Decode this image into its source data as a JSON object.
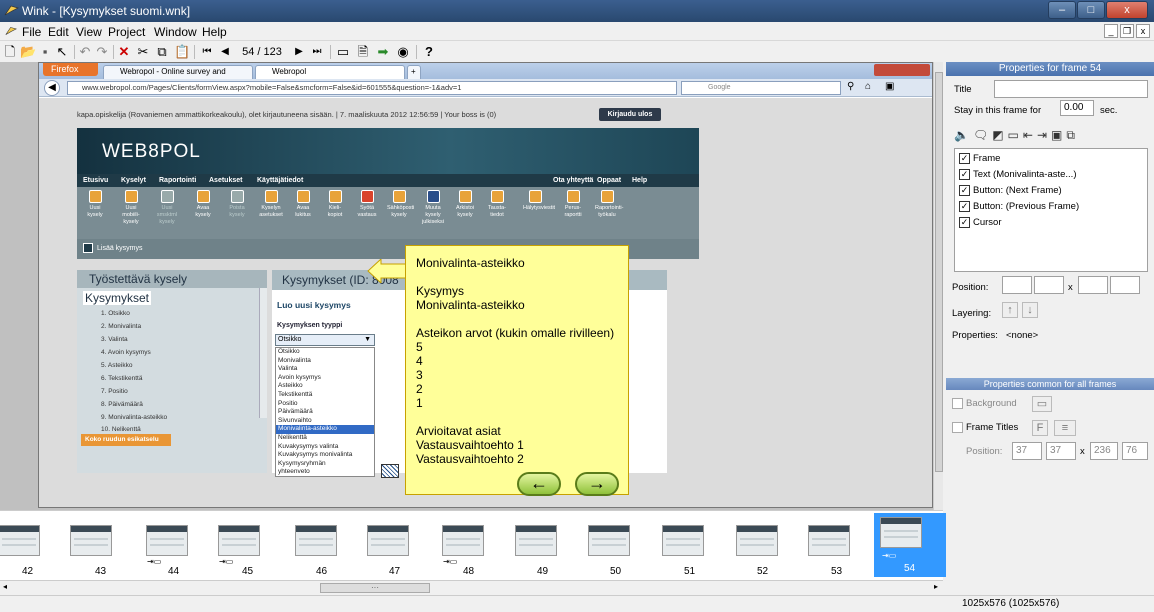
{
  "window": {
    "title": "Wink - [Kysymykset suomi.wnk]",
    "min": "–",
    "max": "□",
    "close": "x"
  },
  "menu": {
    "file": "File",
    "edit": "Edit",
    "view": "View",
    "project": "Project",
    "window": "Window",
    "help": "Help"
  },
  "toolbar": {
    "frame_counter": "54 / 123"
  },
  "browser": {
    "firefox_button": "Firefox",
    "tab1": "Webropol - Online survey and analysi...",
    "tab2": "Webropol",
    "url": "www.webropol.com/Pages/Clients/formView.aspx?mobile=False&smcform=False&id=601555&question=-1&adv=1",
    "search": "Google"
  },
  "webropol": {
    "user_line": "kapa.opiskelija (Rovaniemen ammattikorkeakoulu), olet kirjautuneena sisään. | 7. maaliskuuta 2012 12:56:59 | Your boss is (0)",
    "logout": "Kirjaudu ulos",
    "logo": "WEB8POL",
    "nav": [
      "Etusivu",
      "Kyselyt",
      "Raportointi",
      "Asetukset",
      "Käyttäjätiedot"
    ],
    "nav_right": [
      "Ota yhteyttä",
      "Oppaat",
      "Help"
    ],
    "icons": [
      "Uusi\nkysely",
      "Uusi\nmobiili-\nkysely",
      "Uusi\nsmsktml\nkysely",
      "Avaa\nkysely",
      "Poista\nkysely",
      "Kyselyn\nasetukset",
      "Avaa\nlukitus",
      "Kieli-\nkopiot",
      "Syötä\nvastaus",
      "Sähköposti\nkysely",
      "Muuta\nkysely\njulkiseksi",
      "Arkistoi\nkysely",
      "Tausta-\ntiedot",
      "Hälytysviestit",
      "Perus-\nraportti",
      "Raportointi-\ntyökalu"
    ],
    "add_question": "Lisää kysymys",
    "left_title": "Työstettävä kysely",
    "kysymykset": "Kysymykset",
    "question_list": [
      "1. Otsikko",
      "2. Monivalinta",
      "3. Valinta",
      "4. Avoin kysymys",
      "5. Asteikko",
      "6. Tekstikenttä",
      "7. Positio",
      "8. Päivämäärä",
      "9. Monivalinta-asteikko",
      "10. Nelikenttä"
    ],
    "preview_button": "Koko ruudun esikatselu",
    "right_title": "Kysymykset (ID: 8008"
  },
  "editor": {
    "create_title": "Luo uusi kysymys",
    "type_label": "Kysymyksen tyyppi",
    "type_value": "Otsikko",
    "dropdown_options": [
      "Otsikko",
      "Monivalinta",
      "Valinta",
      "Avoin kysymys",
      "Asteikko",
      "Tekstikenttä",
      "Positio",
      "Päivämäärä",
      "Sivunvaihto",
      "Monivalinta-asteikko",
      "Nelikenttä",
      "Kuvakysymys valinta",
      "Kuvakysymys monivalinta",
      "Kysymysryhmän",
      "yhteenveto"
    ]
  },
  "callout": {
    "lines": [
      "Monivalinta-asteikko",
      "",
      "Kysymys",
      "Monivalinta-asteikko",
      "",
      "Asteikon arvot (kukin omalle rivilleen)",
      "5",
      "4",
      "3",
      "2",
      "1",
      "",
      "Arvioitavat asiat",
      "Vastausvaihtoehto 1",
      "Vastausvaihtoehto 2"
    ],
    "prev": "←",
    "next": "→"
  },
  "thumbnails": [
    "42",
    "43",
    "44",
    "45",
    "46",
    "47",
    "48",
    "49",
    "50",
    "51",
    "52",
    "53",
    "54"
  ],
  "status": "1025x576 (1025x576)",
  "properties": {
    "header": "Properties for frame 54",
    "title_label": "Title",
    "title_value": "",
    "stay_label": "Stay in this frame for",
    "stay_value": "0.00",
    "stay_unit": "sec.",
    "objects": [
      "Frame",
      "Text (Monivalinta-aste...)",
      "Button: (Next Frame)",
      "Button: (Previous Frame)",
      "Cursor"
    ],
    "position_label": "Position:",
    "x_label": "x",
    "layering_label": "Layering:",
    "properties_label": "Properties:",
    "properties_value": "<none>",
    "common_header": "Properties common for all frames",
    "background_label": "Background",
    "frame_titles_label": "Frame Titles",
    "pos2_label": "Position:",
    "pos_vals": [
      "37",
      "37",
      "236",
      "76"
    ]
  },
  "colors": {
    "accent": "#3399ff",
    "callout": "#ffff99"
  }
}
